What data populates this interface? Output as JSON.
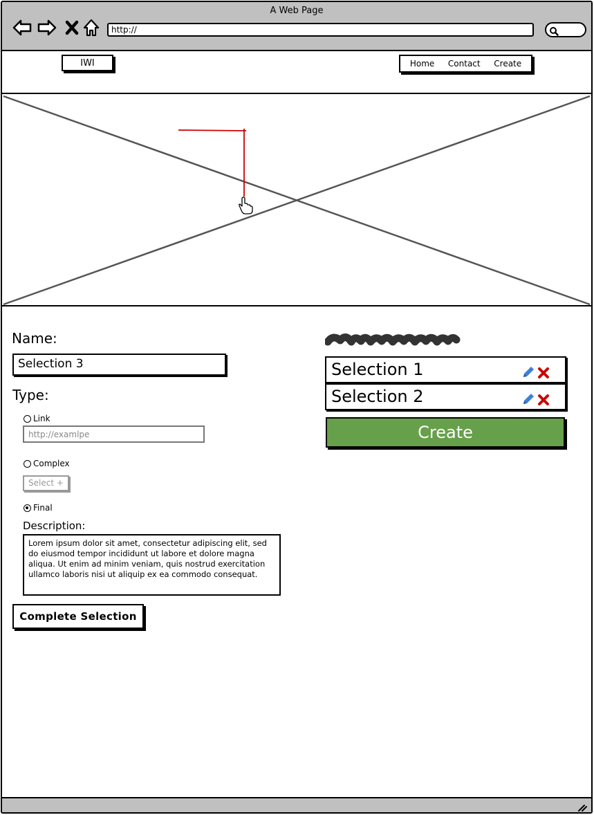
{
  "window": {
    "title": "A Web Page",
    "url": "http://"
  },
  "toolbar": {
    "back_icon": "arrow-left-icon",
    "forward_icon": "arrow-right-icon",
    "stop_icon": "close-icon",
    "home_icon": "home-icon",
    "search_icon": "search-icon"
  },
  "header": {
    "logo": "IWI",
    "nav": [
      "Home",
      "Contact",
      "Create"
    ]
  },
  "form": {
    "name_label": "Name:",
    "name_value": "Selection 3",
    "type_label": "Type:",
    "options": [
      {
        "label": "Link",
        "selected": false
      },
      {
        "label": "Complex",
        "selected": false
      },
      {
        "label": "Final",
        "selected": true
      }
    ],
    "link_placeholder": "http://examlpe",
    "select_button": "Select +",
    "description_label": "Description:",
    "description_text": "Lorem ipsum dolor sit amet, consectetur adipiscing elit, sed do eiusmod tempor incididunt ut labore et dolore magna aliqua. Ut enim ad minim veniam, quis nostrud exercitation ullamco laboris nisi ut aliquip ex ea commodo consequat.",
    "complete_button": "Complete Selection"
  },
  "selections": {
    "items": [
      {
        "label": "Selection 1"
      },
      {
        "label": "Selection 2"
      }
    ],
    "edit_icon": "pencil-icon",
    "delete_icon": "delete-x-icon",
    "create_button": "Create"
  },
  "colors": {
    "chrome": "#c0c0c0",
    "create_green": "#67a04a",
    "edit_blue": "#3d7fd9",
    "delete_red": "#cc0000",
    "annotation_red": "#cc0000"
  }
}
